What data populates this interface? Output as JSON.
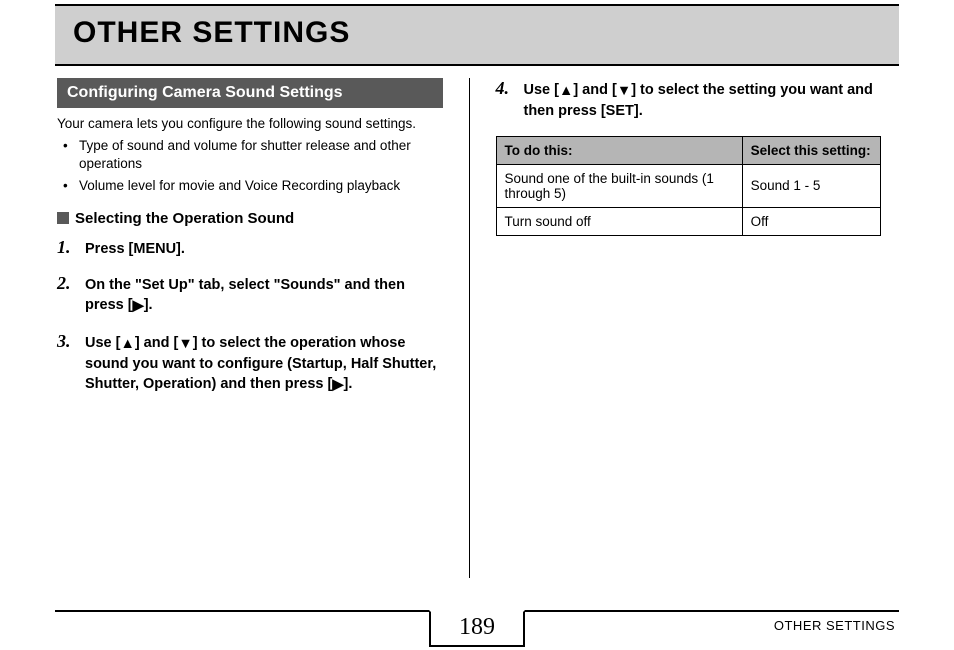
{
  "page_title": "OTHER SETTINGS",
  "section_header": "Configuring Camera Sound Settings",
  "intro": "Your camera lets you configure the following sound settings.",
  "bullets": [
    "Type of sound and volume for shutter release and other operations",
    "Volume level for movie and Voice Recording playback"
  ],
  "subheading": "Selecting the Operation Sound",
  "steps": {
    "s1_num": "1.",
    "s1_body": "Press [MENU].",
    "s2_num": "2.",
    "s2_body_a": "On the \"Set Up\" tab, select \"Sounds\" and then press [",
    "s2_body_b": "].",
    "s3_num": "3.",
    "s3_body_a": "Use [",
    "s3_body_b": "] and [",
    "s3_body_c": "] to select the operation whose sound you want to configure (Startup, Half Shutter, Shutter, Operation) and then press [",
    "s3_body_d": "].",
    "s4_num": "4.",
    "s4_body_a": "Use [",
    "s4_body_b": "] and [",
    "s4_body_c": "] to select the setting you want and then press [SET]."
  },
  "table": {
    "header_left": "To do this:",
    "header_right": "Select this setting:",
    "rows": [
      {
        "left": "Sound one of the built-in sounds (1 through 5)",
        "right": "Sound 1 - 5"
      },
      {
        "left": "Turn sound off",
        "right": "Off"
      }
    ]
  },
  "page_number": "189",
  "footer_label": "OTHER SETTINGS",
  "icons": {
    "tri_up": "▲",
    "tri_down": "▼",
    "tri_right": "▶"
  }
}
